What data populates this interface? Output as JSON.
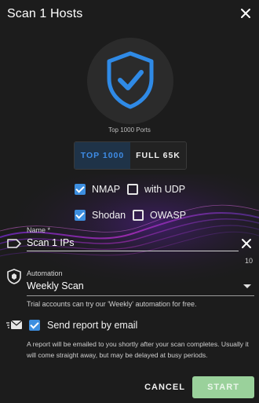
{
  "dialog": {
    "title": "Scan 1 Hosts",
    "close_icon": "close-icon"
  },
  "shield": {
    "icon": "shield-check-icon",
    "caption": "Top 1000 Ports"
  },
  "port_toggle": {
    "options": [
      "TOP 1000",
      "FULL 65K"
    ],
    "selected": "TOP 1000"
  },
  "options": {
    "nmap": {
      "label": "NMAP",
      "checked": true
    },
    "udp": {
      "label": "with UDP",
      "checked": false
    },
    "shodan": {
      "label": "Shodan",
      "checked": true
    },
    "owasp": {
      "label": "OWASP",
      "checked": false
    }
  },
  "name_field": {
    "label": "Name *",
    "value": "Scan 1 IPs",
    "counter": "10",
    "icon": "tag-icon"
  },
  "automation": {
    "label": "Automation",
    "value": "Weekly Scan",
    "hint": "Trial accounts can try our 'Weekly' automation for free.",
    "icon": "shield-badge-icon"
  },
  "email_report": {
    "label": "Send report by email",
    "checked": true,
    "icon": "mail-icon",
    "note": "A report will be emailed to you shortly after your scan completes. Usually it will come straight away, but may be delayed at busy periods."
  },
  "actions": {
    "cancel_label": "CANCEL",
    "start_label": "START"
  },
  "colors": {
    "accent": "#3d8fe0",
    "start_button": "#9ad19b",
    "background": "#1c1c1c"
  }
}
